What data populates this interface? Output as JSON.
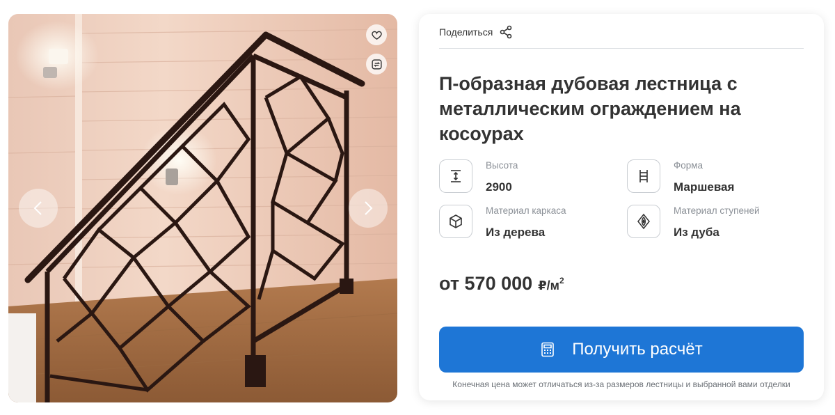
{
  "share": {
    "label": "Поделиться"
  },
  "product": {
    "title": "П-образная дубовая лестница с металлическим ограждением на косоурах"
  },
  "specs": [
    {
      "label": "Высота",
      "value": "2900",
      "icon": "height-icon"
    },
    {
      "label": "Форма",
      "value": "Маршевая",
      "icon": "ladder-icon"
    },
    {
      "label": "Материал каркаса",
      "value": "Из дерева",
      "icon": "cube-icon"
    },
    {
      "label": "Материал ступеней",
      "value": "Из дуба",
      "icon": "wood-grain-icon"
    }
  ],
  "price": {
    "main": "от 570 000",
    "unit": "₽/м",
    "unit_power": "2"
  },
  "cta": {
    "label": "Получить расчёт",
    "icon": "calculator-icon"
  },
  "note": "Конечная цена может отличаться из-за размеров лестницы и выбранной вами отделки",
  "gallery": {
    "icons": [
      "heart-icon",
      "compare-icon",
      "chevron-left-icon",
      "chevron-right-icon"
    ]
  },
  "colors": {
    "accent": "#1e76d6",
    "text": "#333333",
    "muted": "#8a8f96"
  }
}
